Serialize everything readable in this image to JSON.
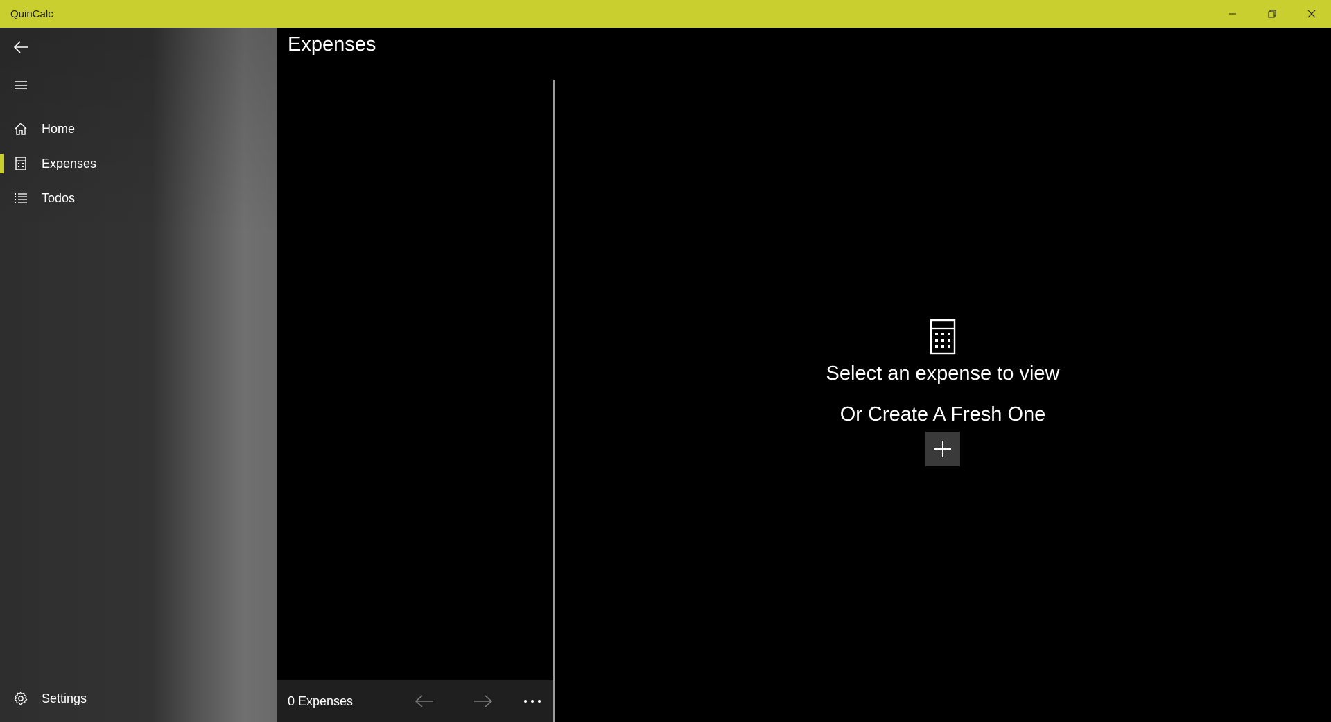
{
  "window": {
    "title": "QuinCalc"
  },
  "sidebar": {
    "items": [
      {
        "label": "Home",
        "icon": "home-icon"
      },
      {
        "label": "Expenses",
        "icon": "calculator-icon",
        "selected": true
      },
      {
        "label": "Todos",
        "icon": "list-icon"
      }
    ],
    "settings_label": "Settings",
    "accent_color": "#c8cf2e"
  },
  "main": {
    "title": "Expenses",
    "list_count_label": "0 Expenses",
    "empty_state": {
      "line1": "Select an expense to view",
      "line2": "Or Create A Fresh One"
    }
  }
}
